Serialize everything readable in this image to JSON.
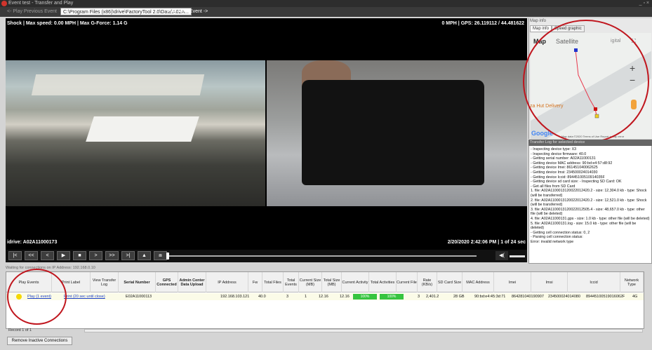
{
  "window": {
    "title": "Event test - Transfer and Play"
  },
  "nav": {
    "prev": "<- Play Previous Event",
    "path": "C:\\Program Files (x86)\\drive\\FactoryTool 2.0\\Data\\A02A...",
    "next": "Play Next Event ->"
  },
  "video": {
    "info_left": "Shock | Max speed: 0.00 MPH | Max G-Force: 1.14 G",
    "info_right": "0 MPH | GPS: 26.119112 / 44.481622",
    "driver": "idrive: A02A11000173",
    "time": "2/20/2020 2:42:06 PM | 1 of 24 sec"
  },
  "controls": {
    "buttons": [
      "|<",
      "<<",
      "<",
      "▶",
      "■",
      ">",
      ">>",
      ">|",
      "▲",
      "⧈"
    ],
    "volume": "◀("
  },
  "map": {
    "header": "Map info",
    "tabs": [
      "Map info",
      "Speed graphic"
    ],
    "type_map": "Map",
    "type_satellite": "Satellite",
    "digital": "igital",
    "poi": "za Hut Delivery",
    "google": "Google",
    "footer": "Map data ©2020   Terms of Use   Report a map error",
    "zoom_in": "+",
    "zoom_out": "−",
    "fullscreen": "⛶"
  },
  "log": {
    "header": "Transfer Log for selected device",
    "lines": [
      "- Inspecting device type: X3",
      "- Inspecting device firmware: 40.0",
      "- Getting serial number: A02A11000131",
      "- Getting device MAC address: 90:bd:e4:57:d8:92",
      "- Getting device Imei: 861451040062625",
      "- Getting device Imsi: 234500024014030",
      "- Getting device Iccid: 89445100510914035F",
      "- Getting device sd card size: - Inspecting SD Card: OK",
      "- Get all files from SD Card",
      "1. file: A02A1100013120022012420.2 - size: 12,304.0 kb - type: Shock (will be transferred)",
      "2. file: A02A1100013120022012420.2 - size: 12,521.0 kb - type: Shock (will be transferred)",
      "3. file: A02A1100013120022012505.4 - size: 48,657.0 kb - type: other file (will be deleted)",
      "4. file: A02A11000131.gps - size: 1.0 kb - type: other file (will be deleted)",
      "5. file: A02A11000131.log - size: 15.0 kb - type: other file (will be deleted)",
      "- Getting cell connection status: 0, 2",
      "- Parsing cell connection status:",
      "Error: invalid network type"
    ]
  },
  "grid": {
    "status": "Waiting for connections on IP Address: 192.168.0.10",
    "headers": [
      "Play Events",
      "Print Label",
      "View Transfer Log",
      "Serial Number",
      "GPS Connected",
      "Admin Center Data Upload",
      "IP Address",
      "Fw",
      "Total Files",
      "Total Events",
      "Current Size (MB)",
      "Total Size (MB)",
      "Current Activity",
      "Total Activities",
      "Current File",
      "Rate (KB/s)",
      "SD Card Size",
      "MAC Address",
      "Imei",
      "Imsi",
      "Iccid",
      "Network Type"
    ],
    "row": {
      "play": "Play (1 event)",
      "print": "Print (20 sec until close)",
      "serial": "E02A11000113",
      "ip": "192.168.103.121",
      "fw": "40.0",
      "total_files": "3",
      "total_events": "1",
      "current_size": "12.16",
      "total_size": "12.16",
      "current_activity": "100%",
      "total_activities": "100%",
      "current_file": "3",
      "rate": "2,401.2",
      "sd": "28 GB",
      "mac": "90:bd:e4:45:3d:71",
      "imei": "864281040190907",
      "imsi": "234500024014080",
      "iccid": "89445100519016062F",
      "network": "4G"
    },
    "pager": "Record 1 of 1",
    "remove_button": "Remove Inactive Connections"
  },
  "colors": {
    "accent_red": "#c0161e",
    "progress_green": "#36c43f",
    "link_blue": "#1a3ec7"
  }
}
